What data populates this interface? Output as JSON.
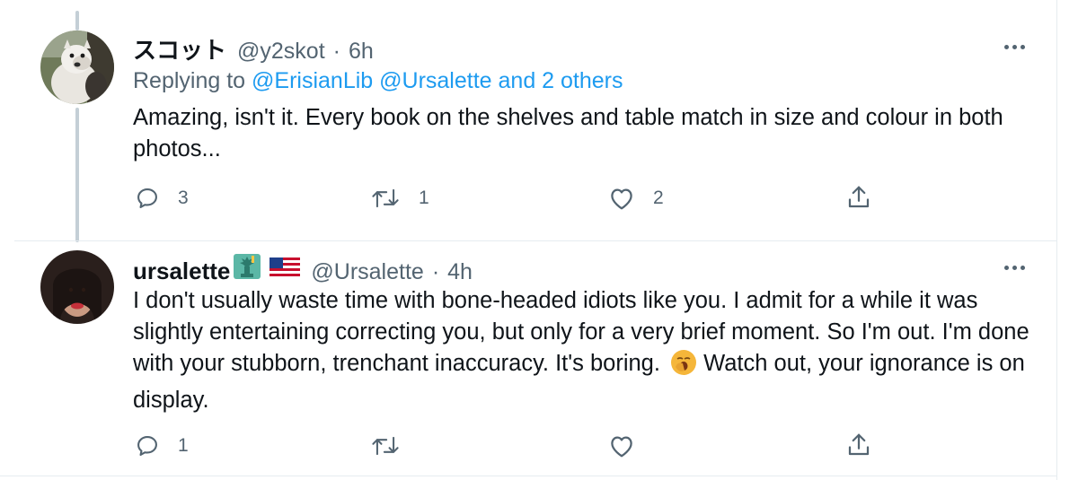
{
  "tweets": [
    {
      "display_name": "スコット",
      "handle": "@y2skot",
      "separator": "·",
      "time": "6h",
      "replying": {
        "prefix": "Replying to",
        "mention1": "@ErisianLib",
        "mention2": "@Ursalette",
        "suffix": "and 2 others"
      },
      "text": "Amazing, isn't it. Every book on the shelves and table match in size and colour in both photos...",
      "counts": {
        "reply": "3",
        "retweet": "1",
        "like": "2"
      },
      "icons": {
        "reply": "reply-icon",
        "retweet": "retweet-icon",
        "like": "like-icon",
        "share": "share-icon",
        "more": "more-icon"
      }
    },
    {
      "display_name": "ursalette",
      "name_emojis": [
        "statue-of-liberty-emoji",
        "us-flag-emoji"
      ],
      "handle": "@Ursalette",
      "separator": "·",
      "time": "4h",
      "text_before_emoji": "I don't usually waste time with bone-headed idiots like you. I admit for a while it was slightly entertaining correcting you, but only for a very brief moment. So I'm out. I'm done with your stubborn, trenchant inaccuracy. It's boring.",
      "inline_emoji": "yawning-face-emoji",
      "text_after_emoji": "Watch out, your ignorance is on display.",
      "counts": {
        "reply": "1",
        "retweet": "",
        "like": ""
      },
      "icons": {
        "reply": "reply-icon",
        "retweet": "retweet-icon",
        "like": "like-icon",
        "share": "share-icon",
        "more": "more-icon"
      }
    }
  ],
  "colors": {
    "text_primary": "#0f1419",
    "text_secondary": "#536471",
    "link": "#1d9bf0",
    "thread_line": "#c4cfd6",
    "divider": "#e6ecf0"
  }
}
